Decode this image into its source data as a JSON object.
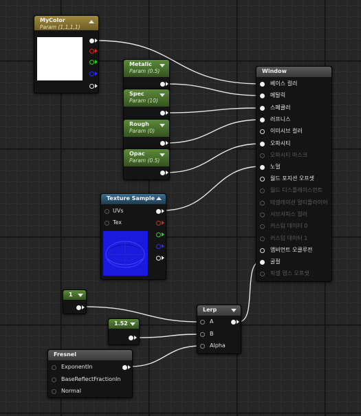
{
  "nodes": {
    "mycolor": {
      "title": "MyColor",
      "subtitle": "Param (1,1,1,1)",
      "color": "#ffffff"
    },
    "metalic": {
      "title": "Metalic",
      "subtitle": "Param (0.5)"
    },
    "spec": {
      "title": "Spec",
      "subtitle": "Param (10)"
    },
    "rough": {
      "title": "Rough",
      "subtitle": "Param (0)"
    },
    "opac": {
      "title": "Opac",
      "subtitle": "Param (0.5)"
    },
    "texture": {
      "title": "Texture Sample",
      "inputs": [
        "UVs",
        "Tex"
      ],
      "preview_color": "#1a1adf"
    },
    "const1": {
      "value": "1"
    },
    "const152": {
      "value": "1.52"
    },
    "lerp": {
      "title": "Lerp",
      "inputs": [
        "A",
        "B",
        "Alpha"
      ]
    },
    "fresnel": {
      "title": "Fresnel",
      "inputs": [
        "ExponentIn",
        "BaseReflectFractionIn",
        "Normal"
      ]
    },
    "window": {
      "title": "Window",
      "inputs": [
        {
          "label": "베이스 컬러",
          "enabled": true
        },
        {
          "label": "메탈릭",
          "enabled": true
        },
        {
          "label": "스페큘러",
          "enabled": true
        },
        {
          "label": "러프니스",
          "enabled": true
        },
        {
          "label": "이미시브 컬러",
          "enabled": true
        },
        {
          "label": "오파시티",
          "enabled": true
        },
        {
          "label": "오파시티 마스크",
          "enabled": false
        },
        {
          "label": "노멀",
          "enabled": true
        },
        {
          "label": "월드 포지션 오프셋",
          "enabled": true
        },
        {
          "label": "월드 디스플레이스먼트",
          "enabled": false
        },
        {
          "label": "테셀레이션 멀티플라이어",
          "enabled": false
        },
        {
          "label": "서브서피스 컬러",
          "enabled": false
        },
        {
          "label": "커스텀 데이터 0",
          "enabled": false
        },
        {
          "label": "커스텀 데이터 1",
          "enabled": false
        },
        {
          "label": "앰비언트 오클루전",
          "enabled": true
        },
        {
          "label": "굴절",
          "enabled": true
        },
        {
          "label": "픽셀 뎁스 오프셋",
          "enabled": false
        }
      ]
    }
  },
  "colors": {
    "param_header": "#5c8a3a",
    "vector_header": "#a08a3e",
    "texture_header": "#3b6e8e",
    "function_header": "#5a5a5a",
    "wire": "#e8e8e8"
  }
}
